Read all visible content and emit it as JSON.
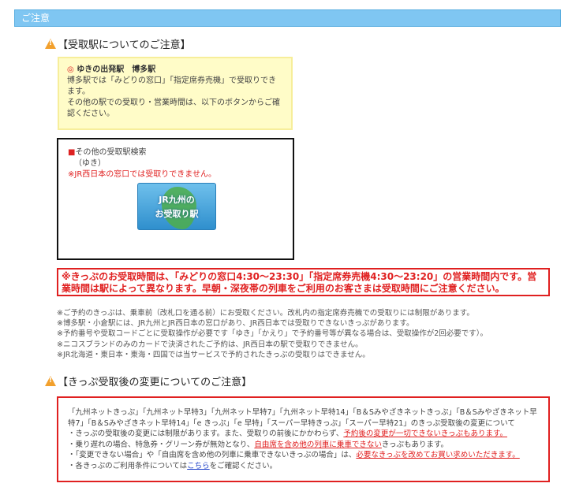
{
  "header": {
    "title": "ご注意"
  },
  "section1": {
    "title": "【受取駅についてのご注意】",
    "origin_mark": "◎",
    "origin_label": "ゆきの出発駅　博多駅",
    "line1": "博多駅では「みどりの窓口」「指定席券売機」で受取りできます。",
    "line2": "その他の駅での受取り・営業時間は、以下のボタンからご確認ください。"
  },
  "search": {
    "square": "■",
    "title": "その他の受取駅検索",
    "direction": "（ゆき）",
    "warning": "※JR西日本の窓口では受取りできません。",
    "button_line1": "JR九州の",
    "button_line2": "お受取り駅"
  },
  "notice": {
    "text": "※きっぷのお受取時間は、「みどりの窓口4:30～23:30」「指定席券売機4:30～23:20」の営業時間内です。営業時間は駅によって異なります。早朝・深夜帯の列車をご利用のお客さまは受取時間にご注意ください。"
  },
  "notes": [
    "※ご予約のきっぷは、乗車前（改札口を通る前）にお受取ください。改札内の指定席券売機での受取りには制限があります。",
    "※博多駅・小倉駅には、JR九州とJR西日本の窓口があり、JR西日本では受取りできないきっぷがあります。",
    "※予約番号や受取コードごとに受取操作が必要です「ゆき」「かえり」で予約番号等が異なる場合は、受取操作が2回必要です）。",
    "※ニコスブランドのみのカードで決済されたご予約は、JR西日本の駅で受取りできません。",
    "※JR北海道・東日本・東海・四国では当サービスで予約されたきっぷの受取りはできません。"
  ],
  "section2": {
    "title": "【きっぷ受取後の変更についてのご注意】",
    "p1": "「九州ネットきっぷ」「九州ネット早特3」「九州ネット早特7」「九州ネット早特14」「B＆Sみやざきネットきっぷ」「B＆Sみやざきネット早特7」「B＆Sみやざきネット早特14」「e きっぷ」「e 早特」「スーパー早特きっぷ」「スーパー早特21」のきっぷ受取後の変更について",
    "p2a": "・きっぷの受取後の変更には制限があります。また、受取りの前後にかかわらず、",
    "p2b": "予約後の変更が一切できないきっぷもあります。",
    "p3a": "・乗り遅れの場合、特急券・グリーン券が無効となり、",
    "p3b": "自由席を含め他の列車に乗車できない",
    "p3c": "きっぷもあります。",
    "p4a": "・「変更できない場合」や「自由席を含め他の列車に乗車できないきっぷの場合」は、",
    "p4b": "必要なきっぷを改めてお買い求めいただきます。",
    "p5a": "・各きっぷのご利用条件については",
    "p5_link": "こちら",
    "p5b": "をご確認ください。"
  }
}
